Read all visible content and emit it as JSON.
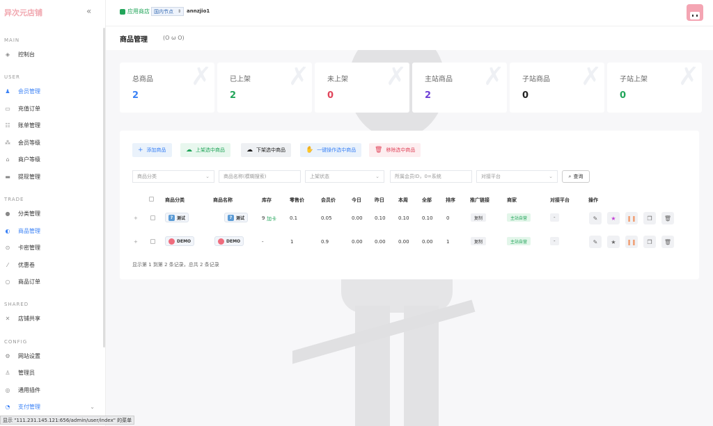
{
  "sidebar": {
    "logo": "异次元店铺",
    "collapse_icon": "«",
    "sections": {
      "main": "MAIN",
      "user": "USER",
      "trade": "TRADE",
      "shared": "SHARED",
      "config": "CONFIG"
    },
    "items": [
      {
        "label": "控制台",
        "icon": "dashboard-icon"
      },
      {
        "label": "会员管理",
        "icon": "user-icon"
      },
      {
        "label": "充值订单",
        "icon": "card-icon"
      },
      {
        "label": "账单管理",
        "icon": "bill-icon"
      },
      {
        "label": "会员等级",
        "icon": "level-icon"
      },
      {
        "label": "商户等级",
        "icon": "merchant-icon"
      },
      {
        "label": "提现管理",
        "icon": "withdraw-icon"
      },
      {
        "label": "分类管理",
        "icon": "category-icon"
      },
      {
        "label": "商品管理",
        "icon": "goods-icon"
      },
      {
        "label": "卡密管理",
        "icon": "key-icon"
      },
      {
        "label": "优惠卷",
        "icon": "coupon-icon"
      },
      {
        "label": "商品订单",
        "icon": "order-icon"
      },
      {
        "label": "店铺共享",
        "icon": "share-icon"
      },
      {
        "label": "网站设置",
        "icon": "gear-icon"
      },
      {
        "label": "管理员",
        "icon": "admin-icon"
      },
      {
        "label": "通用插件",
        "icon": "plugin-icon"
      },
      {
        "label": "支付管理",
        "icon": "pay-icon"
      }
    ]
  },
  "topbar": {
    "app_store": "应用商店",
    "node": "国内节点",
    "username": "annzjio1"
  },
  "page": {
    "title": "商品管理",
    "subtitle": "(O ω O)"
  },
  "stats": [
    {
      "label": "总商品",
      "value": "2",
      "color": "#3b82f6"
    },
    {
      "label": "已上架",
      "value": "2",
      "color": "#22a55a"
    },
    {
      "label": "未上架",
      "value": "0",
      "color": "#e0445a"
    },
    {
      "label": "主站商品",
      "value": "2",
      "color": "#6d3fd6"
    },
    {
      "label": "子站商品",
      "value": "0",
      "color": "#222222"
    },
    {
      "label": "子站上架",
      "value": "0",
      "color": "#22a55a"
    }
  ],
  "toolbar": {
    "add": "添加商品",
    "up": "上架选中商品",
    "down": "下架选中商品",
    "one_click": "一键操作选中商品",
    "delete": "移除选中商品"
  },
  "filters": {
    "category": "商品分类",
    "name": "商品名称(模糊搜索)",
    "status": "上架状态",
    "member": "所属会员ID，0=系统",
    "platform": "对接平台",
    "search": "查询"
  },
  "table": {
    "headers": [
      "商品分类",
      "商品名称",
      "库存",
      "零售价",
      "会员价",
      "今日",
      "昨日",
      "本周",
      "全部",
      "排序",
      "推广链接",
      "商家",
      "对接平台",
      "操作"
    ],
    "rows": [
      {
        "category": "测试",
        "name": "测试",
        "stock": "9",
        "stock_link": "加卡",
        "retail": "0.1",
        "member": "0.05",
        "today": "0.00",
        "yesterday": "0.10",
        "week": "0.10",
        "all": "0.10",
        "sort": "0",
        "promo": "复制",
        "merchant": "主站自营",
        "platform": "-"
      },
      {
        "category": "DEMO",
        "name": "DEMO",
        "stock": "-",
        "stock_link": "",
        "retail": "1",
        "member": "0.9",
        "today": "0.00",
        "yesterday": "0.00",
        "week": "0.00",
        "all": "0.00",
        "sort": "1",
        "promo": "复制",
        "merchant": "主站自营",
        "platform": "-"
      }
    ],
    "footer": "显示第 1 到第 2 条记录，总共 2 条记录"
  },
  "status_url": "显示 \"111.231.145.121:656/admin/user/index\" 的菜单"
}
